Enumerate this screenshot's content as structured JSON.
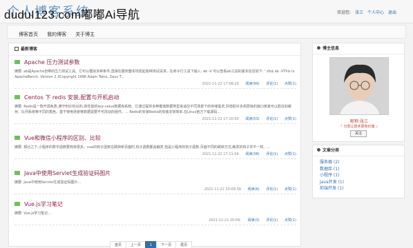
{
  "header": {
    "logo": "个人博客系统",
    "watermark": "duduI123.com嘟嘟Ai导航",
    "welcome": "欢迎您:",
    "username": "张三",
    "personal_center": "个人中心",
    "logout": "退出"
  },
  "nav": [
    "博客首页",
    "我的博客",
    "关于博主"
  ],
  "main": {
    "section_title": "最新博客",
    "articles": [
      {
        "title": "Apache 压力测试参数",
        "summary": "摘要: ab是Apache自带的压力测试工具。它可以模拟多种条件,直接在服务器本地发起各种测试请求。在命令行工具下输入: ab -V 可以查看ab工具的版本信息如下: ' zfs$ ab -VThis is ApacheBench, Version 2.3Copyright 1996 Adam Twiss, Zeus T...",
        "date": "2021-11-22 17:08:20",
        "reads": "阅读(99)",
        "comments": "评论(1)",
        "likes": "点赞(1)"
      },
      {
        "title": "Centos 下 redis 安装,配置与开机启动",
        "summary": "摘要: Redis是一款开源免费,遵守BSD协议的,高性能的key-value数据库系统。它通过提供多种键值数据类型来适应不同场景下的存储需求,并借助许多高层级的接口使其可以胜任如缓存、队列系统等不同的角色。基于使用场景等数据需要不可改动的组件。... Redis的安装Redis的安装非常简单,在Linux官方下载源码...",
        "date": "2021-11-22 17:10:00",
        "reads": "阅读(53)",
        "comments": "评论(1)",
        "likes": "点赞(1)"
      },
      {
        "title": "Vue和微信小程序的区别、比较",
        "summary": "摘要: 相比之下,小程序的数字函数要简单很多。vue的钩子函数在跳转新页面时,钩子函数都会触发,但是小程序的钩子函数,页面不同的跳转方式,触发的钩子并不一样。...",
        "date": "2021-11-22 17:11:04",
        "reads": "阅读(38)",
        "comments": "评论(1)",
        "likes": "点赞(1)"
      },
      {
        "title": "Java中使用Servlet生成验证码图片",
        "summary": "摘要: Java中使用Servlet生成验证码图片...",
        "date": "2021-11-22 20:09:39",
        "reads": "阅读(6)",
        "comments": "评论(1)",
        "likes": "点赞(1)"
      },
      {
        "title": "Vue.js学习笔记",
        "summary": "摘要: Vue.js学习笔记...",
        "date": "2021-11-22 20:09:",
        "reads": "阅读(3)",
        "comments": "评论(1)",
        "likes": "点赞(1)"
      }
    ],
    "pager": [
      "首页",
      "上一页",
      "1",
      "下一页",
      "尾页"
    ]
  },
  "sidebar": {
    "author_title": "博主信息",
    "author_name": "昵称:张三",
    "motto": "『 分享让技术更有价值 』",
    "follow": "关注",
    "category_title": "文章分类",
    "categories": [
      "服务器 (2)",
      "数据库 (1)",
      "小程序 (1)",
      "Java开发 (1)",
      "前端开发 (1)"
    ]
  },
  "colors": {
    "accent": "#2b6fb0",
    "title_color": "#8b1f3f",
    "tag_color": "#6fbf5b"
  }
}
